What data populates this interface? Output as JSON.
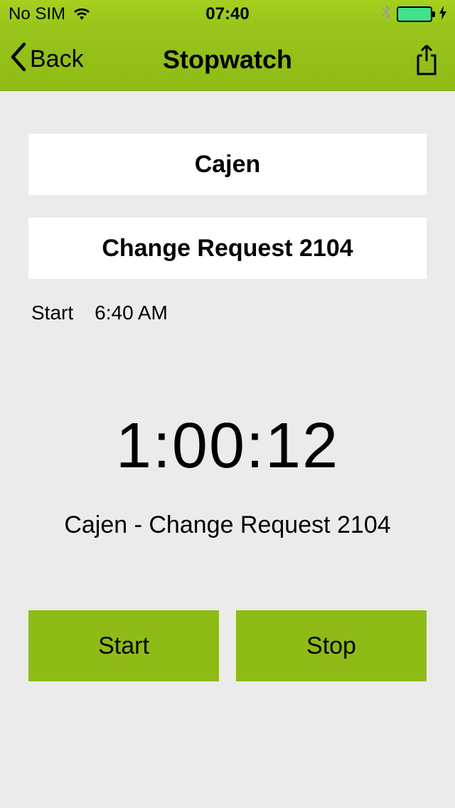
{
  "statusBar": {
    "carrier": "No SIM",
    "time": "07:40"
  },
  "nav": {
    "back": "Back",
    "title": "Stopwatch"
  },
  "fields": {
    "project": "Cajen",
    "task": "Change Request 2104"
  },
  "startRow": {
    "label": "Start",
    "time": "6:40 AM"
  },
  "timer": {
    "value": "1:00:12",
    "description": "Cajen - Change Request 2104"
  },
  "buttons": {
    "start": "Start",
    "stop": "Stop"
  }
}
